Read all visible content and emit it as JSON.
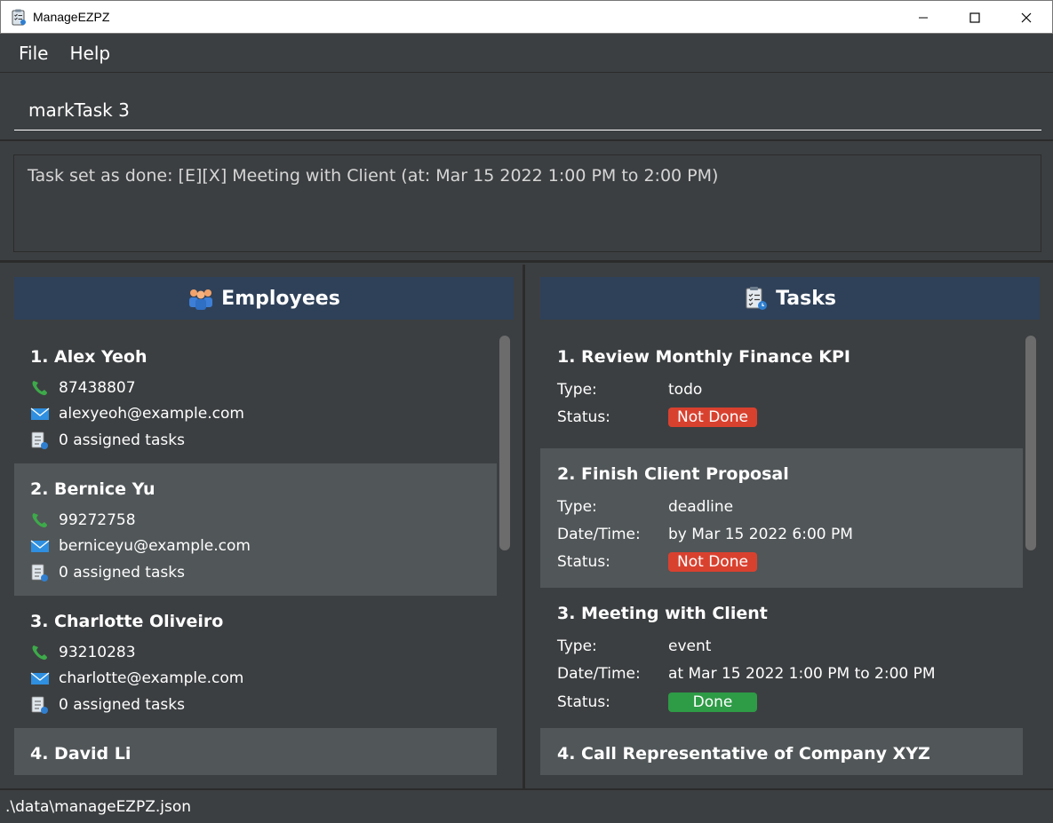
{
  "window": {
    "title": "ManageEZPZ",
    "icon": "clipboard-icon",
    "controls": [
      "minimize-icon",
      "maximize-icon",
      "close-icon"
    ]
  },
  "menu": {
    "file": "File",
    "help": "Help"
  },
  "command": {
    "value": "markTask 3"
  },
  "result": {
    "text": "Task set as done: [E][X] Meeting with Client (at: Mar 15 2022 1:00 PM to 2:00 PM)"
  },
  "employees": {
    "header": "Employees",
    "icon": "people-icon",
    "items": [
      {
        "title": "1.  Alex Yeoh",
        "phone": "87438807",
        "email": "alexyeoh@example.com",
        "tasks": "0 assigned tasks"
      },
      {
        "title": "2.  Bernice Yu",
        "phone": "99272758",
        "email": "berniceyu@example.com",
        "tasks": "0 assigned tasks"
      },
      {
        "title": "3.  Charlotte Oliveiro",
        "phone": "93210283",
        "email": "charlotte@example.com",
        "tasks": "0 assigned tasks"
      },
      {
        "title": "4.  David Li"
      }
    ]
  },
  "tasks": {
    "header": "Tasks",
    "icon": "task-list-icon",
    "labels": {
      "type": "Type:",
      "datetime": "Date/Time:",
      "status": "Status:"
    },
    "items": [
      {
        "title": "1.  Review Monthly Finance KPI",
        "type": "todo",
        "status": "Not Done"
      },
      {
        "title": "2.  Finish Client Proposal",
        "type": "deadline",
        "datetime": "by Mar 15 2022 6:00 PM",
        "status": "Not Done"
      },
      {
        "title": "3.  Meeting with Client",
        "type": "event",
        "datetime": "at Mar 15 2022 1:00 PM to 2:00 PM",
        "status": "Done"
      },
      {
        "title": "4.  Call Representative of Company XYZ"
      }
    ]
  },
  "colors": {
    "not_done": "#d9412f",
    "done": "#2e9b46",
    "header_bg": "#2f4159"
  },
  "statusbar": {
    "path": ".\\data\\manageEZPZ.json"
  }
}
